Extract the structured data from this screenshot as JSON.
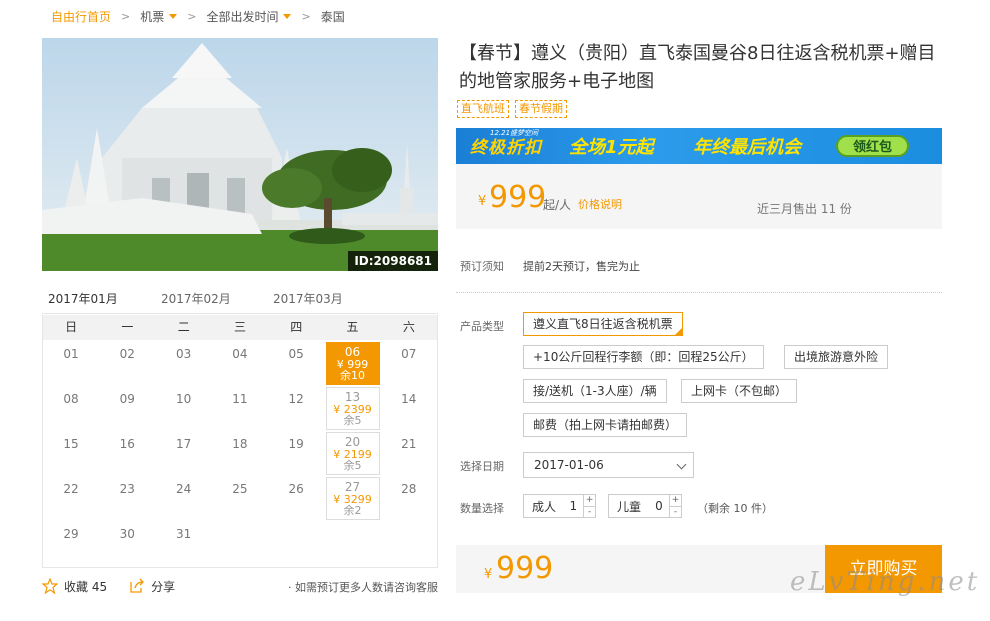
{
  "breadcrumb": {
    "home": "自由行首页",
    "sep": ">",
    "flight": "机票",
    "departure": "全部出发时间",
    "destination": "泰国"
  },
  "image": {
    "id_label": "ID:2098681"
  },
  "calendar": {
    "months": [
      "2017年01月",
      "2017年02月",
      "2017年03月"
    ],
    "weekdays": [
      "日",
      "一",
      "二",
      "三",
      "四",
      "五",
      "六"
    ],
    "days": [
      {
        "d": "01"
      },
      {
        "d": "02"
      },
      {
        "d": "03"
      },
      {
        "d": "04"
      },
      {
        "d": "05"
      },
      {
        "d": "06",
        "price": "¥ 999",
        "rem": "余10",
        "selected": true
      },
      {
        "d": "07"
      },
      {
        "d": "08"
      },
      {
        "d": "09"
      },
      {
        "d": "10"
      },
      {
        "d": "11"
      },
      {
        "d": "12"
      },
      {
        "d": "13",
        "price": "¥ 2399",
        "rem": "余5"
      },
      {
        "d": "14"
      },
      {
        "d": "15"
      },
      {
        "d": "16"
      },
      {
        "d": "17"
      },
      {
        "d": "18"
      },
      {
        "d": "19"
      },
      {
        "d": "20",
        "price": "¥ 2199",
        "rem": "余5"
      },
      {
        "d": "21"
      },
      {
        "d": "22"
      },
      {
        "d": "23"
      },
      {
        "d": "24"
      },
      {
        "d": "25"
      },
      {
        "d": "26"
      },
      {
        "d": "27",
        "price": "¥ 3299",
        "rem": "余2"
      },
      {
        "d": "28"
      },
      {
        "d": "29"
      },
      {
        "d": "30"
      },
      {
        "d": "31"
      }
    ]
  },
  "actions": {
    "favorite": "收藏 45",
    "share": "分享",
    "consult": "· 如需预订更多人数请咨询客服"
  },
  "product": {
    "title": "【春节】遵义（贵阳）直飞泰国曼谷8日往返含税机票+赠目的地管家服务+电子地图",
    "tags": [
      "直飞航班",
      "春节假期"
    ]
  },
  "banner": {
    "small": "12.21盛梦空间",
    "slogan1": "终极折扣",
    "slogan2": "全场1元起",
    "slogan3": "年终最后机会",
    "button": "领红包"
  },
  "price": {
    "yen": "¥",
    "amount": "999",
    "per": "起/人",
    "explain": "价格说明",
    "sold": "近三月售出 11 份"
  },
  "booking": {
    "notice_label": "预订须知",
    "notice_text": "提前2天预订，售完为止",
    "type_label": "产品类型",
    "options": [
      "遵义直飞8日往返含税机票",
      "+10公斤回程行李额（即：回程25公斤）",
      "出境旅游意外险",
      "接/送机（1-3人座）/辆",
      "上网卡（不包邮）",
      "邮费（拍上网卡请拍邮费）"
    ],
    "date_label": "选择日期",
    "date_value": "2017-01-06",
    "qty_label": "数量选择",
    "adult_label": "成人",
    "adult_value": "1",
    "child_label": "儿童",
    "child_value": "0",
    "plus": "+",
    "minus": "-",
    "remain": "（剩余 10 件）"
  },
  "buy": {
    "yen": "¥",
    "amount": "999",
    "button": "立即购买"
  },
  "watermark": "eLvTing.net"
}
